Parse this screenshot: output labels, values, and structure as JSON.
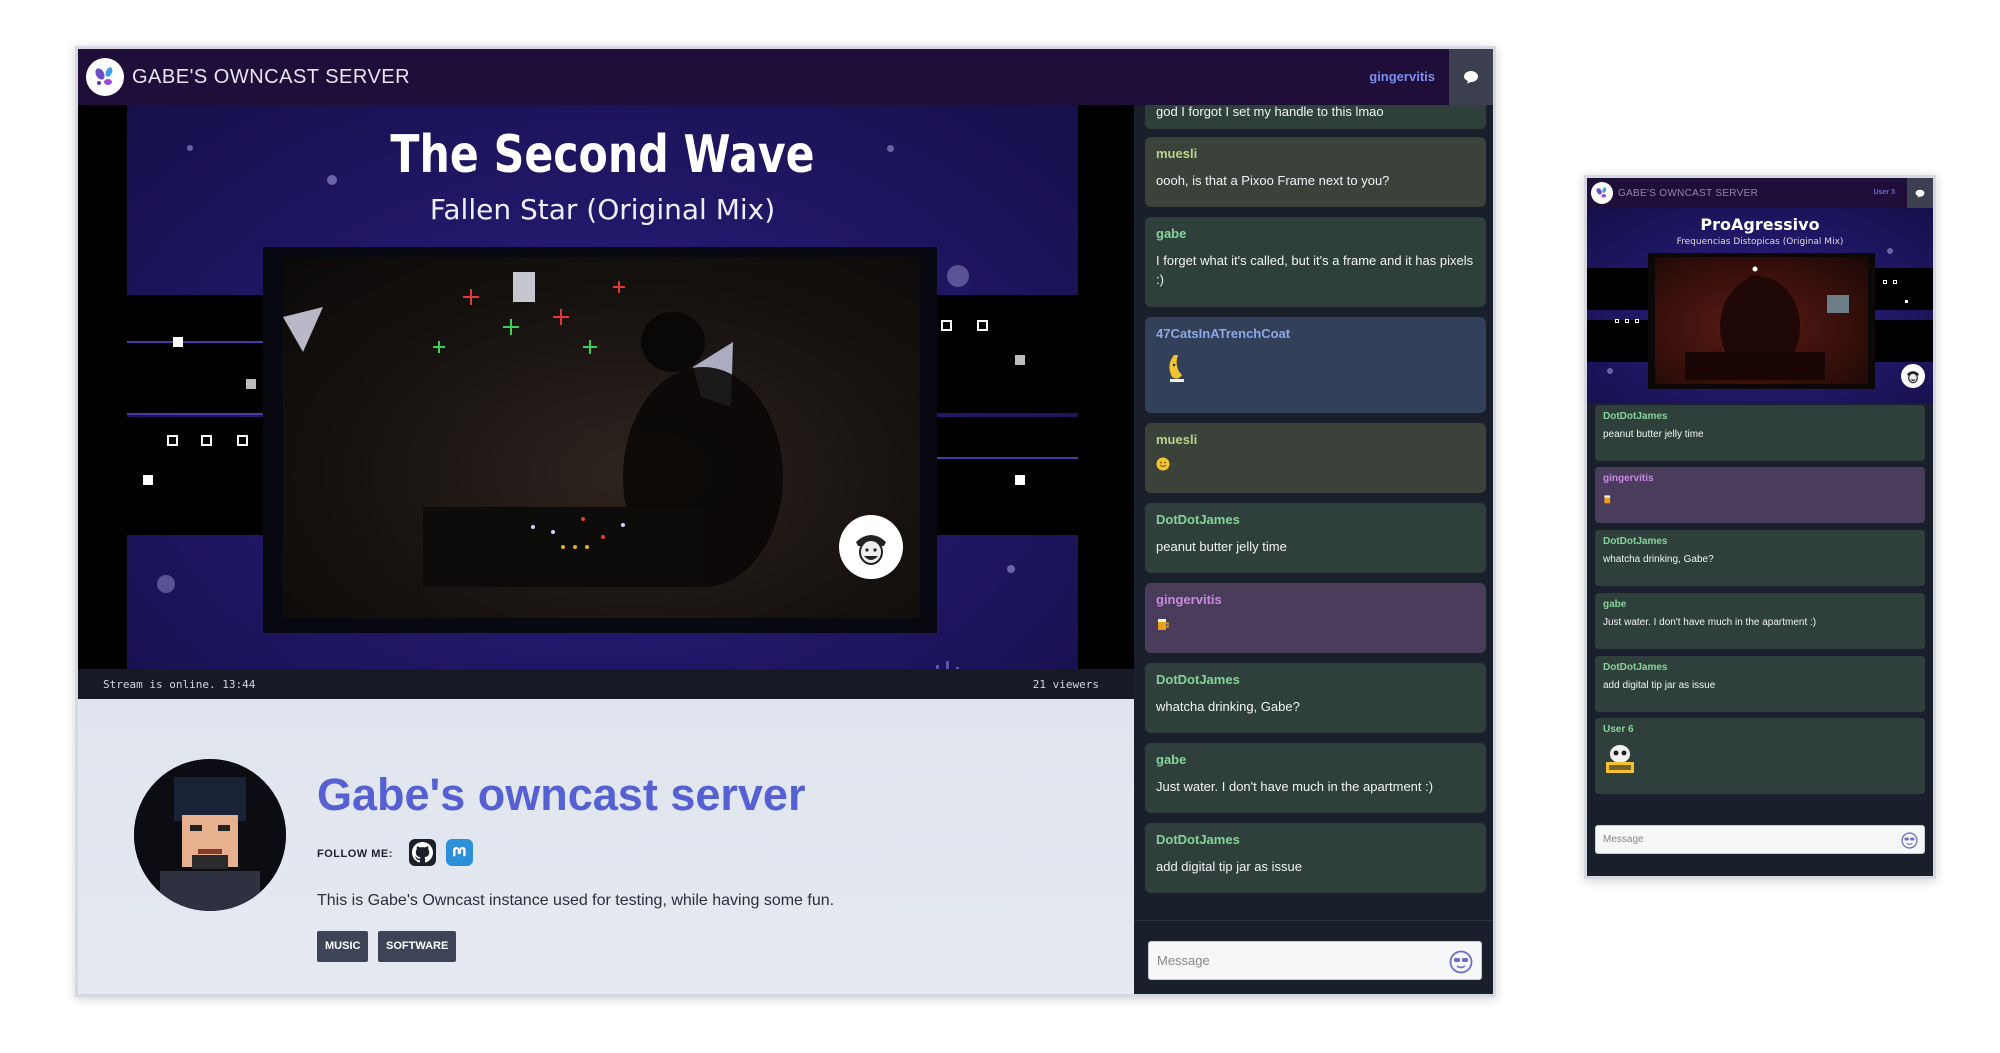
{
  "desktop": {
    "site_title": "GABE'S OWNCAST SERVER",
    "username": "gingervitis",
    "video": {
      "title": "The Second Wave",
      "subtitle": "Fallen Star (Original Mix)",
      "status": "Stream is online. 13:44",
      "viewers": "21 viewers"
    },
    "about": {
      "name": "Gabe's owncast server",
      "follow_label": "FOLLOW ME:",
      "social": [
        "github-icon",
        "mastodon-icon"
      ],
      "description": "This is Gabe's Owncast instance used for testing, while having some fun.",
      "tags": [
        "MUSIC",
        "SOFTWARE"
      ]
    },
    "chat": {
      "messages": [
        {
          "user": "",
          "text": "god I forgot I set my handle to this lmao",
          "color": "#2f3f3b",
          "user_color": "#9ad39a"
        },
        {
          "user": "muesli",
          "text": "oooh, is that a Pixoo Frame next to you?",
          "color": "#3a4239",
          "user_color": "#b9d48a"
        },
        {
          "user": "gabe",
          "text": "I forget what it's called, but it's a frame and it has pixels :)",
          "color": "#2f403c",
          "user_color": "#86d39a"
        },
        {
          "user": "47CatsInATrenchCoat",
          "text": "",
          "color": "#33405a",
          "user_color": "#8ea8e6"
        },
        {
          "user": "muesli",
          "text": "",
          "color": "#3a4239",
          "user_color": "#b9d48a"
        },
        {
          "user": "DotDotJames",
          "text": "peanut butter jelly time",
          "color": "#2f403c",
          "user_color": "#86d39a"
        },
        {
          "user": "gingervitis",
          "text": "",
          "color": "#4a3d5c",
          "user_color": "#c98ae0"
        },
        {
          "user": "DotDotJames",
          "text": "whatcha drinking, Gabe?",
          "color": "#2f403c",
          "user_color": "#86d39a"
        },
        {
          "user": "gabe",
          "text": "Just water. I don't have much in the apartment :)",
          "color": "#2f403c",
          "user_color": "#86d39a"
        },
        {
          "user": "DotDotJames",
          "text": "add digital tip jar as issue",
          "color": "#2f403c",
          "user_color": "#86d39a"
        }
      ],
      "placeholder": "Message"
    }
  },
  "mobile": {
    "site_title": "GABE'S OWNCAST SERVER",
    "username": "User 3",
    "video": {
      "title": "ProAgressivo",
      "subtitle": "Frequencias Distopicas (Original Mix)"
    },
    "chat": {
      "messages": [
        {
          "user": "DotDotJames",
          "text": "peanut butter jelly time",
          "color": "#2f403c",
          "user_color": "#86d39a"
        },
        {
          "user": "gingervitis",
          "text": "",
          "color": "#4a3d5c",
          "user_color": "#c98ae0"
        },
        {
          "user": "DotDotJames",
          "text": "whatcha drinking, Gabe?",
          "color": "#2f403c",
          "user_color": "#86d39a"
        },
        {
          "user": "gabe",
          "text": "Just water. I don't have much in the apartment :)",
          "color": "#2f403c",
          "user_color": "#86d39a"
        },
        {
          "user": "DotDotJames",
          "text": "add digital tip jar as issue",
          "color": "#2f403c",
          "user_color": "#86d39a"
        },
        {
          "user": "User 6",
          "text": "",
          "color": "#2f403c",
          "user_color": "#86d39a"
        }
      ],
      "placeholder": "Message"
    }
  },
  "colors": {
    "topbar": "#200e3a",
    "accent": "#5561d3",
    "chat_bg": "#1a1f2c"
  }
}
